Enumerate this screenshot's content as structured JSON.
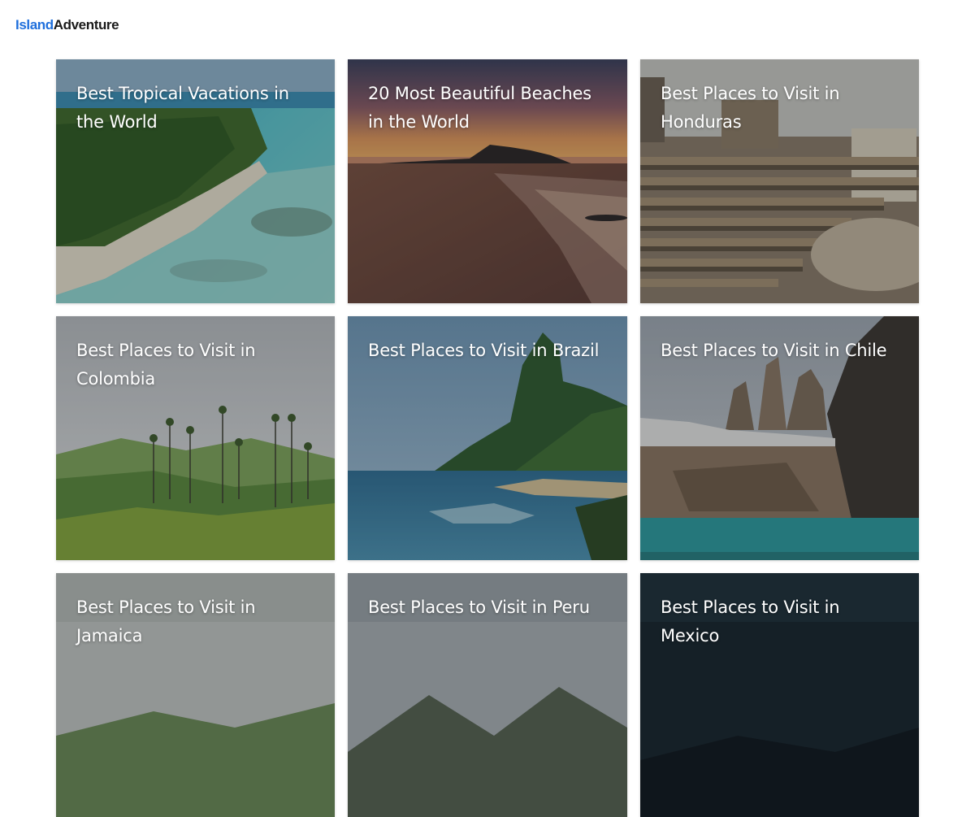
{
  "header": {
    "logo_part1": "Island",
    "logo_part2": "Adventure"
  },
  "cards": [
    {
      "title": "Best Tropical Vacations in the World",
      "image": "tropical-beach-aerial"
    },
    {
      "title": "20 Most Beautiful Beaches in the World",
      "image": "sunset-beach"
    },
    {
      "title": "Best Places to Visit in Honduras",
      "image": "ancient-amphitheater-ruins"
    },
    {
      "title": "Best Places to Visit in Colombia",
      "image": "wax-palm-valley"
    },
    {
      "title": "Best Places to Visit in Brazil",
      "image": "coastal-peak-bay"
    },
    {
      "title": "Best Places to Visit in Chile",
      "image": "granite-towers-lake"
    },
    {
      "title": "Best Places to Visit in Jamaica",
      "image": "cloudy-hills"
    },
    {
      "title": "Best Places to Visit in Peru",
      "image": "misty-mountains"
    },
    {
      "title": "Best Places to Visit in Mexico",
      "image": "night-sky"
    }
  ]
}
